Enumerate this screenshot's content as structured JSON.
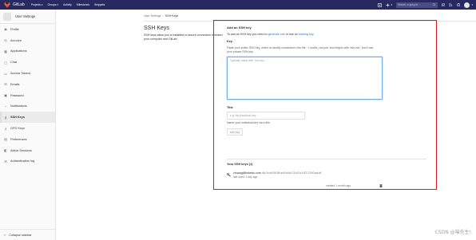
{
  "navbar": {
    "brand": "GitLab",
    "links": [
      {
        "label": "Projects",
        "has_caret": true
      },
      {
        "label": "Groups",
        "has_caret": true
      },
      {
        "label": "Activity",
        "has_caret": false
      },
      {
        "label": "Milestones",
        "has_caret": false
      },
      {
        "label": "Snippets",
        "has_caret": false
      }
    ],
    "search_placeholder": "Search or jump to...",
    "colors": {
      "background": "#292961",
      "search_background": "#4b4b85"
    }
  },
  "sidebar": {
    "title": "User Settings",
    "items": [
      {
        "label": "Profile",
        "icon": "profile-icon"
      },
      {
        "label": "Account",
        "icon": "account-icon"
      },
      {
        "label": "Applications",
        "icon": "applications-icon"
      },
      {
        "label": "Chat",
        "icon": "chat-icon"
      },
      {
        "label": "Access Tokens",
        "icon": "token-icon"
      },
      {
        "label": "Emails",
        "icon": "email-icon"
      },
      {
        "label": "Password",
        "icon": "lock-icon"
      },
      {
        "label": "Notifications",
        "icon": "bell-icon"
      },
      {
        "label": "SSH Keys",
        "icon": "key-icon",
        "active": true
      },
      {
        "label": "GPG Keys",
        "icon": "key-icon"
      },
      {
        "label": "Preferences",
        "icon": "preferences-icon"
      },
      {
        "label": "Active Sessions",
        "icon": "sessions-icon"
      },
      {
        "label": "Authentication log",
        "icon": "log-icon"
      }
    ],
    "collapse_label": "Collapse sidebar"
  },
  "breadcrumb": {
    "parent": "User Settings",
    "current": "SSH Keys"
  },
  "page": {
    "title": "SSH Keys",
    "description": "SSH keys allow you to establish a secure connection between your computer and GitLab."
  },
  "form": {
    "heading": "Add an SSH key",
    "intro_prefix": "To add an SSH key you need to ",
    "intro_link1": "generate one",
    "intro_middle": " or use an ",
    "intro_link2": "existing key",
    "intro_suffix": ".",
    "key_label": "Key",
    "key_help": "Paste your public SSH key, which is usually contained in the file '~/.ssh/id_rsa.pub' and begins with 'ssh-rsa'. Don't use your private SSH key.",
    "key_placeholder": "Typically starts with \"ssh-rsa ...\"",
    "title_label": "Title",
    "title_placeholder": "e.g. My MacBook key",
    "title_help": "Name your individual key via a title",
    "add_button": "Add key"
  },
  "keys": {
    "heading": "Your SSH keys (1)",
    "items": [
      {
        "title": "zhuang@kokebu.com",
        "fingerprint": "4b:2c:bf:26:56:ed:0d:fc:21:b2:b1:67:23:f0:ad:df",
        "last_used": "last used: 1 day ago",
        "created": "created 1 month ago"
      }
    ]
  },
  "watermark": "CSDN @喵先生!",
  "accent_colors": {
    "link": "#1f78d1",
    "highlight_box": "#e21b1b"
  }
}
